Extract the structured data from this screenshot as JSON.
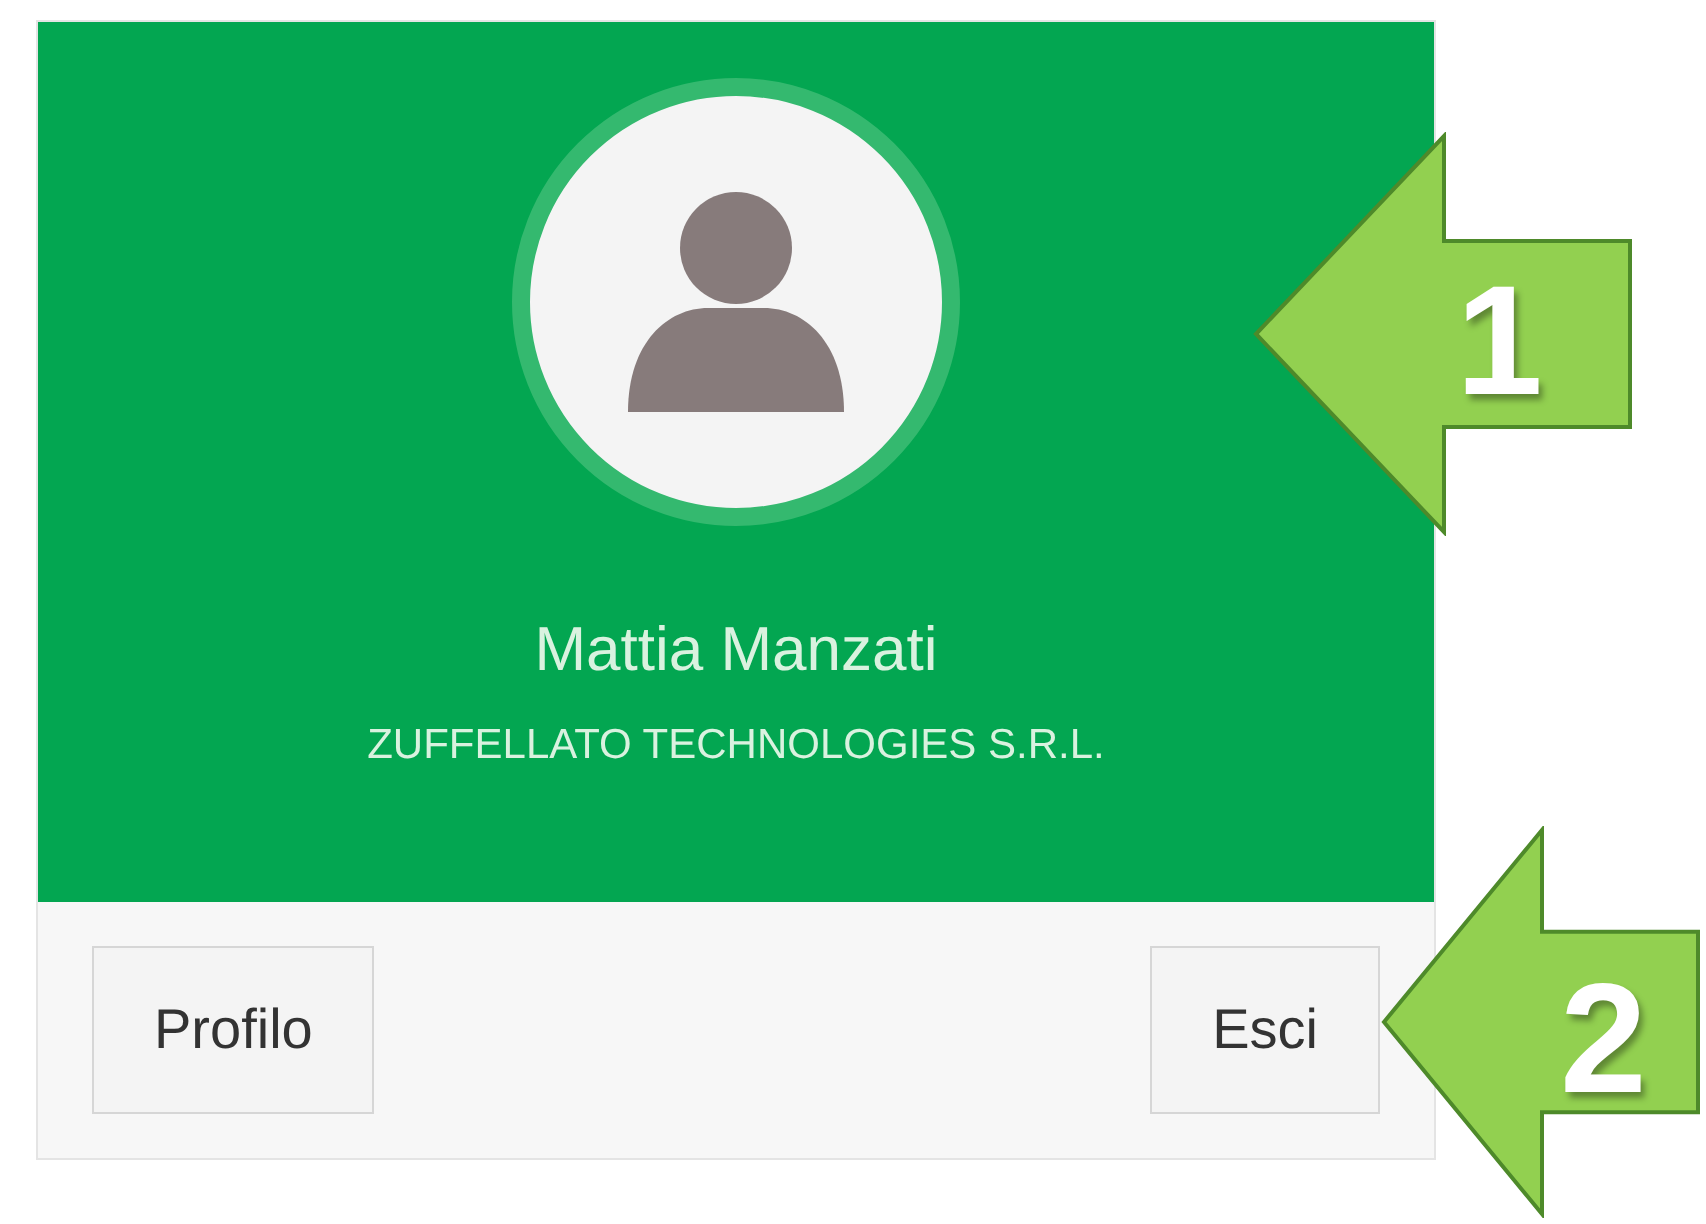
{
  "profile": {
    "name": "Mattia Manzati",
    "company": "ZUFFELLATO TECHNOLOGIES S.R.L."
  },
  "buttons": [
    {
      "label": "Profilo"
    },
    {
      "label": "Esci"
    }
  ],
  "callouts": [
    {
      "number": "1"
    },
    {
      "number": "2"
    }
  ]
}
